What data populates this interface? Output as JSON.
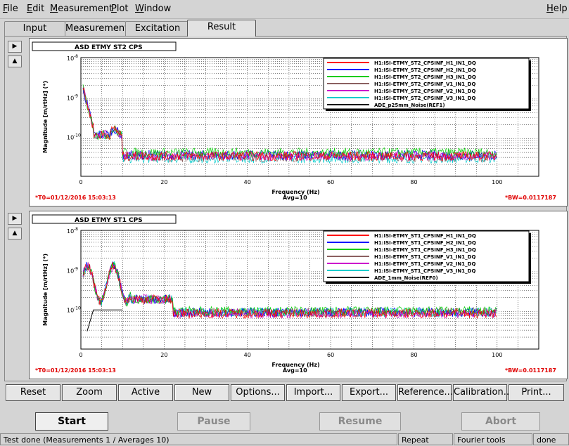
{
  "menu": [
    {
      "key": "file",
      "label": "File"
    },
    {
      "key": "edit",
      "label": "Edit"
    },
    {
      "key": "measurement",
      "label": "Measurement"
    },
    {
      "key": "plot",
      "label": "Plot"
    },
    {
      "key": "window",
      "label": "Window"
    },
    {
      "key": "help",
      "label": "Help"
    }
  ],
  "tabs": [
    "Input",
    "Measurement",
    "Excitation",
    "Result"
  ],
  "active_tab": "Result",
  "plots": [
    {
      "title": "ASD ETMY ST2 CPS",
      "ylabel": "Magnitude [m/rtHz] (*)",
      "xlabel": "Frequency (Hz)",
      "ytick_labels": [
        "10",
        "10",
        "10"
      ],
      "ytick_exps": [
        "-8",
        "-9",
        "-10"
      ],
      "xtick_labels": [
        "0",
        "20",
        "40",
        "60",
        "80",
        "100"
      ],
      "legend": [
        {
          "label": "H1:ISI-ETMY_ST2_CPSINF_H1_IN1_DQ",
          "color": "#ff0000"
        },
        {
          "label": "H1:ISI-ETMY_ST2_CPSINF_H2_IN1_DQ",
          "color": "#0000ff"
        },
        {
          "label": "H1:ISI-ETMY_ST2_CPSINF_H3_IN1_DQ",
          "color": "#00cc00"
        },
        {
          "label": "H1:ISI-ETMY_ST2_CPSINF_V1_IN1_DQ",
          "color": "#8b6060"
        },
        {
          "label": "H1:ISI-ETMY_ST2_CPSINF_V2_IN1_DQ",
          "color": "#cc00cc"
        },
        {
          "label": "H1:ISI-ETMY_ST2_CPSINF_V3_IN1_DQ",
          "color": "#00cccc"
        },
        {
          "label": "ADE_p25mm_Noise(REF1)",
          "color": "#000000"
        }
      ],
      "t0": "*T0=01/12/2016 15:03:13",
      "avg": "Avg=10",
      "bw": "*BW=0.0117187"
    },
    {
      "title": "ASD ETMY ST1 CPS",
      "ylabel": "Magnitude [m/rtHz] (*)",
      "xlabel": "Frequency (Hz)",
      "ytick_labels": [
        "10",
        "10",
        "10"
      ],
      "ytick_exps": [
        "-8",
        "-9",
        "-10"
      ],
      "xtick_labels": [
        "0",
        "20",
        "40",
        "60",
        "80",
        "100"
      ],
      "legend": [
        {
          "label": "H1:ISI-ETMY_ST1_CPSINF_H1_IN1_DQ",
          "color": "#ff0000"
        },
        {
          "label": "H1:ISI-ETMY_ST1_CPSINF_H2_IN1_DQ",
          "color": "#0000ff"
        },
        {
          "label": "H1:ISI-ETMY_ST1_CPSINF_H3_IN1_DQ",
          "color": "#00cc00"
        },
        {
          "label": "H1:ISI-ETMY_ST1_CPSINF_V1_IN1_DQ",
          "color": "#8b6060"
        },
        {
          "label": "H1:ISI-ETMY_ST1_CPSINF_V2_IN1_DQ",
          "color": "#cc00cc"
        },
        {
          "label": "H1:ISI-ETMY_ST1_CPSINF_V3_IN1_DQ",
          "color": "#00cccc"
        },
        {
          "label": "ADE_1mm_Noise(REF0)",
          "color": "#000000"
        }
      ],
      "t0": "*T0=01/12/2016 15:03:13",
      "avg": "Avg=10",
      "bw": "*BW=0.0117187"
    }
  ],
  "actions": [
    "Reset",
    "Zoom",
    "Active",
    "New",
    "Options...",
    "Import...",
    "Export...",
    "Reference...",
    "Calibration...",
    "Print..."
  ],
  "controls": {
    "start": "Start",
    "pause": "Pause",
    "resume": "Resume",
    "abort": "Abort"
  },
  "status": {
    "message": "Test done (Measurements 1 / Averages 10)",
    "mode": "Repeat",
    "tools": "Fourier tools",
    "state": "done"
  }
}
